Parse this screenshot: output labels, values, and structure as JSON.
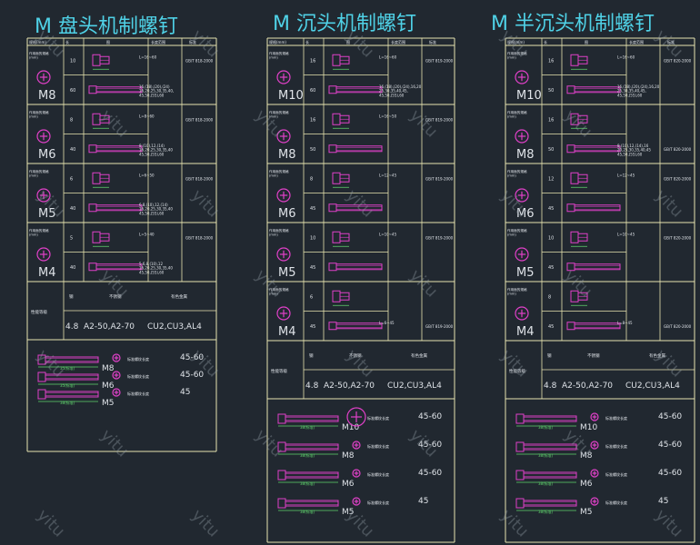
{
  "colors": {
    "background": "#212830",
    "frame": "#e8e4b0",
    "title": "#4fd1e6",
    "cyan": "#5ec8da",
    "magenta": "#e040c8",
    "white": "#dfe3e8",
    "green": "#5fd36c",
    "watermark": "#97a3ad"
  },
  "watermark_text": "yitu",
  "columns": [
    {
      "title": "M 盘头机制螺钉",
      "header": [
        "规格(mm)",
        "长",
        "图",
        "长度范围",
        "标准"
      ],
      "groups": [
        {
          "label": "M8",
          "spec": "作用面的规格\n(mm)",
          "rows": [
            {
              "len": "10",
              "range": "L=16~60",
              "std": "GB/T 818-2000"
            },
            {
              "len": "60",
              "range": "16,(18),(20),(24)\n16,20,25,30,35,40,\n45,50,(55),60",
              "std": ""
            }
          ]
        },
        {
          "label": "M6",
          "spec": "作用面的规格\n(mm)",
          "rows": [
            {
              "len": "8",
              "range": "L=8~60",
              "std": "GB/T 818-2000"
            },
            {
              "len": "40",
              "range": "8,(10),12,(14)\n16,20,25,30,35,40\n45,50,(55),60",
              "std": ""
            }
          ]
        },
        {
          "label": "M5",
          "spec": "作用面的规格\n(mm)",
          "rows": [
            {
              "len": "6",
              "range": "L=6~50",
              "std": "GB/T 818-2000"
            },
            {
              "len": "40",
              "range": "6,8,(10),12,(14)\n16,20,25,30,35,40\n45,50,(55),60",
              "std": ""
            }
          ]
        },
        {
          "label": "M4",
          "spec": "作用面的规格\n(mm)",
          "rows": [
            {
              "len": "5",
              "range": "L=5~40",
              "std": "GB/T 818-2000"
            },
            {
              "len": "40",
              "range": "5,6,8,(10),12\n16,20,25,30,35,40\n45,50,(55),60",
              "std": ""
            }
          ]
        }
      ],
      "material": {
        "label": "性能等级",
        "h1": "钢",
        "h2": "不锈钢",
        "h3": "有色金属",
        "v1": "4.8",
        "v2": "A2-50,A2-70",
        "v3": "CU2,CU3,AL4"
      },
      "samples": [
        {
          "label": "M8",
          "value": "45-60",
          "note": "标准螺纹长度",
          "dim": "35(标准)"
        },
        {
          "label": "M6",
          "value": "45-60",
          "note": "标准螺纹长度",
          "dim": "35(标准)"
        },
        {
          "label": "M5",
          "value": "45",
          "note": "标准螺纹长度",
          "dim": "38(标准)"
        }
      ]
    },
    {
      "title": "M 沉头机制螺钉",
      "header": [
        "规格(mm)",
        "长",
        "图",
        "长度范围",
        "标准"
      ],
      "groups": [
        {
          "label": "M10",
          "spec": "作用面的规格\n(mm)",
          "rows": [
            {
              "len": "16",
              "range": "L=16~60",
              "std": "GB/T 819-2000"
            },
            {
              "len": "60",
              "range": "16,(18),(20),(24),16,20\n25,30,35,40,45,\n45,50,(55),60",
              "std": ""
            }
          ]
        },
        {
          "label": "M8",
          "spec": "作用面的规格\n(mm)",
          "rows": [
            {
              "len": "16",
              "range": "L=16~50",
              "std": "GB/T 819-2000"
            },
            {
              "len": "50",
              "range": "",
              "std": ""
            }
          ]
        },
        {
          "label": "M6",
          "spec": "作用面的规格\n(mm)",
          "rows": [
            {
              "len": "8",
              "range": "L=12~45",
              "std": "GB/T 819-2000"
            },
            {
              "len": "45",
              "range": "",
              "std": ""
            }
          ]
        },
        {
          "label": "M5",
          "spec": "作用面的规格\n(mm)",
          "rows": [
            {
              "len": "10",
              "range": "L=10~45",
              "std": "GB/T 819-2000"
            },
            {
              "len": "45",
              "range": "",
              "std": ""
            }
          ]
        },
        {
          "label": "M4",
          "spec": "作用面的规格\n(mm)",
          "rows": [
            {
              "len": "6",
              "range": "",
              "std": ""
            },
            {
              "len": "45",
              "range": "L=6~45",
              "std": "GB/T 819-2000"
            }
          ]
        }
      ],
      "material": {
        "label": "性能等级",
        "h1": "钢",
        "h2": "不锈钢",
        "h3": "有色金属",
        "v1": "4.8",
        "v2": "A2-50,A2-70",
        "v3": "CU2,CU3,AL4"
      },
      "samples": [
        {
          "label": "M10",
          "value": "45-60",
          "note": "标准螺纹长度",
          "dim": "38(标准)"
        },
        {
          "label": "M8",
          "value": "45-60",
          "note": "标准螺纹长度",
          "dim": "38(标准)"
        },
        {
          "label": "M6",
          "value": "45-60",
          "note": "标准螺纹长度",
          "dim": "38(标准)"
        },
        {
          "label": "M5",
          "value": "45",
          "note": "标准螺纹长度",
          "dim": "38(标准)"
        }
      ]
    },
    {
      "title": "M 半沉头机制螺钉",
      "header": [
        "规格(mm)",
        "长",
        "图",
        "长度范围",
        "标准"
      ],
      "groups": [
        {
          "label": "M10",
          "spec": "作用面的规格\n(mm)",
          "rows": [
            {
              "len": "16",
              "range": "L=16~60",
              "std": "GB/T 820-2000"
            },
            {
              "len": "50",
              "range": "16,(18),(20),(24),16,20\n25,30,35,40,45,\n45,50,(55),60",
              "std": ""
            }
          ]
        },
        {
          "label": "M8",
          "spec": "作用面的规格\n(mm)",
          "rows": [
            {
              "len": "16",
              "range": "",
              "std": ""
            },
            {
              "len": "50",
              "range": "8,(10),12,(14),16\n20,25,30,35,40,45\n45,50,(55),60",
              "std": "GB/T 820-2000"
            }
          ]
        },
        {
          "label": "M6",
          "spec": "作用面的规格\n(mm)",
          "rows": [
            {
              "len": "12",
              "range": "L=12~45",
              "std": "GB/T 820-2000"
            },
            {
              "len": "45",
              "range": "",
              "std": ""
            }
          ]
        },
        {
          "label": "M5",
          "spec": "作用面的规格\n(mm)",
          "rows": [
            {
              "len": "10",
              "range": "L=10~45",
              "std": "GB/T 820-2000"
            },
            {
              "len": "45",
              "range": "",
              "std": ""
            }
          ]
        },
        {
          "label": "M4",
          "spec": "作用面的规格\n(mm)",
          "rows": [
            {
              "len": "8",
              "range": "",
              "std": ""
            },
            {
              "len": "45",
              "range": "L=8~45",
              "std": "GB/T 820-2000"
            }
          ]
        }
      ],
      "material": {
        "label": "性能等级",
        "h1": "钢",
        "h2": "不锈钢",
        "h3": "有色金属",
        "v1": "4.8",
        "v2": "A2-50,A2-70",
        "v3": "CU2,CU3,AL4"
      },
      "samples": [
        {
          "label": "M10",
          "value": "45-60",
          "note": "标准螺纹长度",
          "dim": "38(标准)"
        },
        {
          "label": "M8",
          "value": "45-60",
          "note": "标准螺纹长度",
          "dim": "38(标准)"
        },
        {
          "label": "M6",
          "value": "45-60",
          "note": "标准螺纹长度",
          "dim": "38(标准)"
        },
        {
          "label": "M5",
          "value": "45",
          "note": "标准螺纹长度",
          "dim": "38(标准)"
        }
      ]
    }
  ]
}
